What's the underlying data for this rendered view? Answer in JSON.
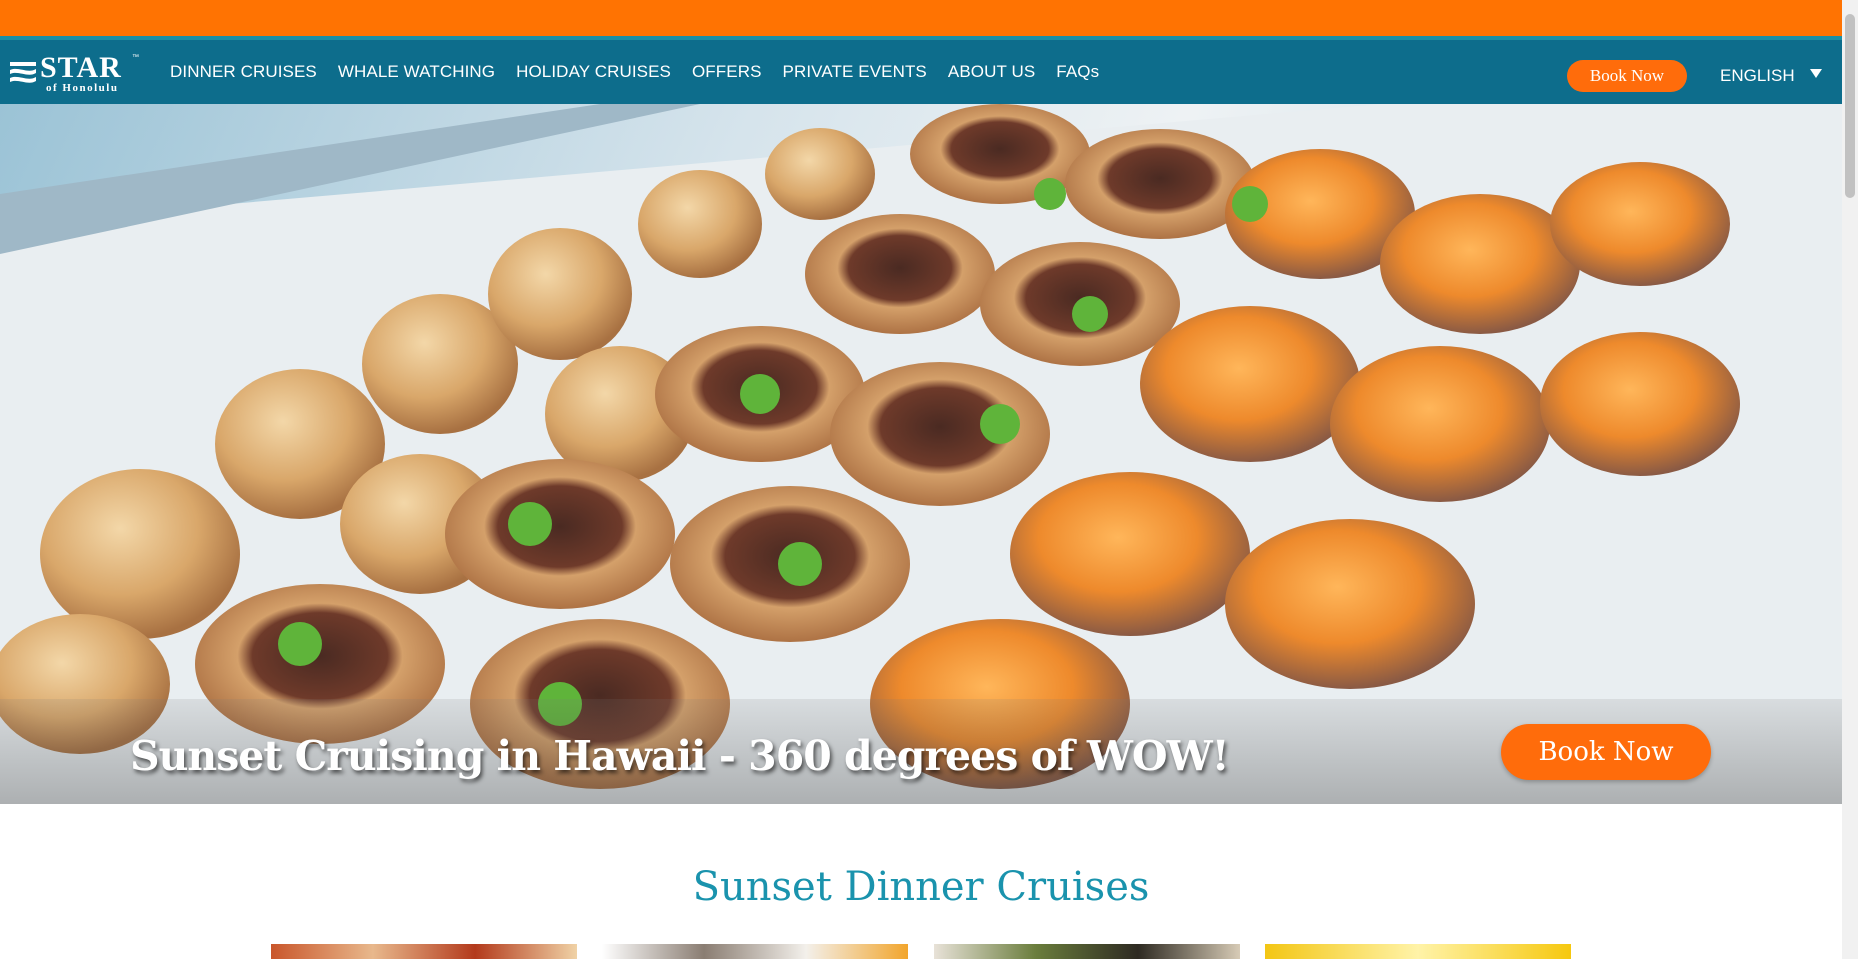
{
  "logo": {
    "name": "STAR",
    "tm": "™",
    "subtitle": "of Honolulu"
  },
  "nav": {
    "items": [
      "DINNER CRUISES",
      "WHALE WATCHING",
      "HOLIDAY CRUISES",
      "OFFERS",
      "PRIVATE EVENTS",
      "ABOUT US",
      "FAQs"
    ],
    "book_label": "Book Now",
    "language": "ENGLISH"
  },
  "hero": {
    "title": "Sunset Cruising in Hawaii - 360 degrees of WOW!",
    "book_label": "Book Now"
  },
  "section": {
    "title": "Sunset Dinner Cruises"
  },
  "colors": {
    "accent_orange": "#ff7302",
    "nav_teal": "#0d6d8c",
    "heading_teal": "#1a93ad",
    "button_orange": "#ff6c0b"
  }
}
